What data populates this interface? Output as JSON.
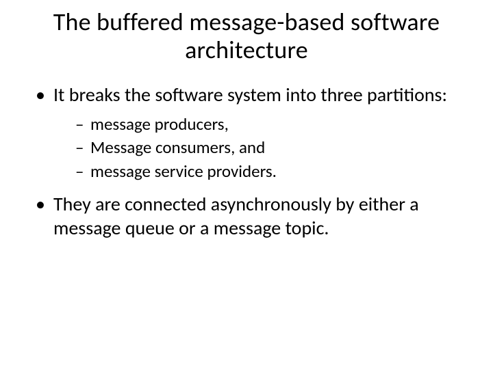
{
  "slide": {
    "title": "The buffered message-based software architecture",
    "bullets": [
      {
        "text": "It breaks the software system into three partitions:",
        "sub": [
          "message producers,",
          "Message consumers, and",
          "message service providers."
        ]
      },
      {
        "text": "They are connected asynchronously by either a message queue or a message topic."
      }
    ]
  }
}
